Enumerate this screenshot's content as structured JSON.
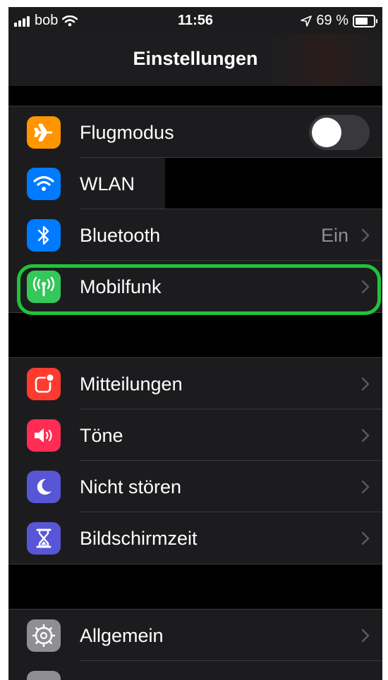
{
  "status_bar": {
    "carrier": "bob",
    "time": "11:56",
    "battery_text": "69 %",
    "battery_level": 0.69
  },
  "nav": {
    "title": "Einstellungen"
  },
  "groups": [
    {
      "rows": [
        {
          "label": "Flugmodus",
          "icon": "airplane-icon",
          "icon_color": "#ff9500",
          "control": "toggle",
          "toggle_on": false
        },
        {
          "label": "WLAN",
          "icon": "wifi-icon",
          "icon_color": "#007aff",
          "control": "redacted"
        },
        {
          "label": "Bluetooth",
          "icon": "bluetooth-icon",
          "icon_color": "#007aff",
          "value": "Ein",
          "control": "chevron"
        },
        {
          "label": "Mobilfunk",
          "icon": "antenna-icon",
          "icon_color": "#34c759",
          "control": "chevron",
          "highlighted": true
        }
      ]
    },
    {
      "rows": [
        {
          "label": "Mitteilungen",
          "icon": "notifications-icon",
          "icon_color": "#ff3b30",
          "control": "chevron"
        },
        {
          "label": "Töne",
          "icon": "speaker-icon",
          "icon_color": "#ff2d55",
          "control": "chevron"
        },
        {
          "label": "Nicht stören",
          "icon": "moon-icon",
          "icon_color": "#5856d6",
          "control": "chevron"
        },
        {
          "label": "Bildschirmzeit",
          "icon": "hourglass-icon",
          "icon_color": "#5856d6",
          "control": "chevron"
        }
      ]
    },
    {
      "rows": [
        {
          "label": "Allgemein",
          "icon": "gear-icon",
          "icon_color": "#8e8e93",
          "control": "chevron"
        }
      ]
    }
  ],
  "colors": {
    "background": "#000000",
    "cell": "#1c1c1e",
    "separator": "#3a3a3c",
    "highlight": "#1fc43a"
  }
}
